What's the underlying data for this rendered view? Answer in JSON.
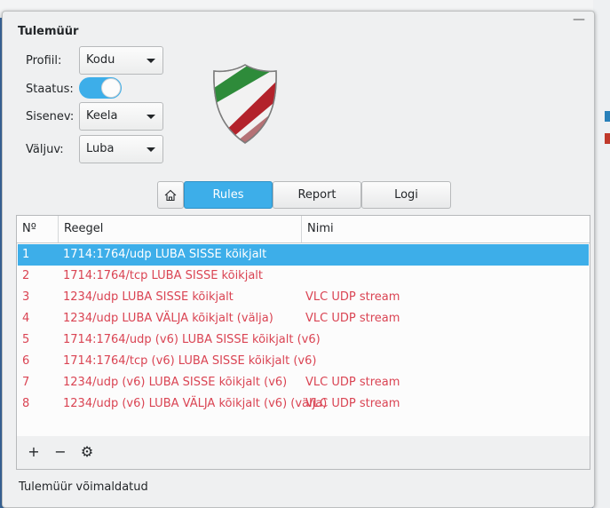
{
  "window": {
    "title": "Tulemüür"
  },
  "settings": {
    "profile_label": "Profiil:",
    "profile_value": "Kodu",
    "status_label": "Staatus:",
    "status_on": true,
    "incoming_label": "Sisenev:",
    "incoming_value": "Keela",
    "outgoing_label": "Väljuv:",
    "outgoing_value": "Luba"
  },
  "tabs": [
    {
      "label": "Rules",
      "active": true
    },
    {
      "label": "Report",
      "active": false
    },
    {
      "label": "Logi",
      "active": false
    }
  ],
  "table": {
    "columns": [
      "Nº",
      "Reegel",
      "Nimi"
    ],
    "rows": [
      {
        "num": "1",
        "rule": "1714:1764/udp LUBA SISSE kõikjalt",
        "name": "",
        "selected": true
      },
      {
        "num": "2",
        "rule": "1714:1764/tcp LUBA SISSE kõikjalt",
        "name": "",
        "selected": false
      },
      {
        "num": "3",
        "rule": "1234/udp LUBA SISSE kõikjalt",
        "name": "VLC UDP stream",
        "selected": false
      },
      {
        "num": "4",
        "rule": "1234/udp LUBA VÄLJA kõikjalt (välja)",
        "name": "VLC UDP stream",
        "selected": false
      },
      {
        "num": "5",
        "rule": "1714:1764/udp (v6) LUBA SISSE kõikjalt (v6)",
        "name": "",
        "selected": false
      },
      {
        "num": "6",
        "rule": "1714:1764/tcp (v6) LUBA SISSE kõikjalt (v6)",
        "name": "",
        "selected": false
      },
      {
        "num": "7",
        "rule": "1234/udp (v6) LUBA SISSE kõikjalt (v6)",
        "name": "VLC UDP stream",
        "selected": false
      },
      {
        "num": "8",
        "rule": "1234/udp (v6) LUBA VÄLJA kõikjalt (v6) (välja)",
        "name": "VLC UDP stream",
        "selected": false
      }
    ]
  },
  "toolbar": {
    "add_icon": "+",
    "remove_icon": "−",
    "settings_icon": "⚙"
  },
  "status": {
    "text": "Tulemüür võimaldatud"
  },
  "colors": {
    "accent": "#3daee9",
    "rule_text": "#da4453"
  },
  "icons": {
    "home": "home-icon",
    "shield": "firewall-shield-icon"
  }
}
